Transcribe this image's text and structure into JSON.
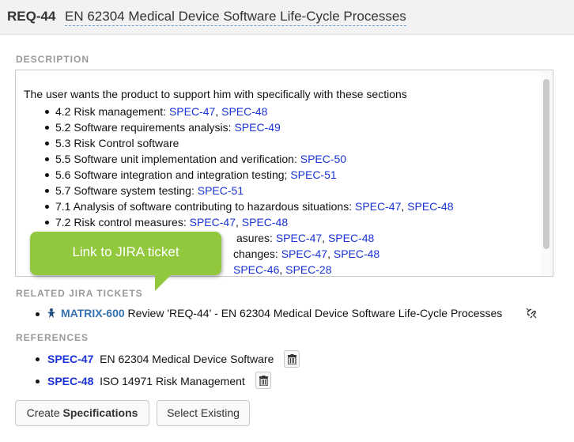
{
  "header": {
    "req_id": "REQ-44",
    "title": "EN 62304 Medical Device Software Life-Cycle Processes"
  },
  "description": {
    "label": "DESCRIPTION",
    "intro": "The user wants the product to support him with specifically with these sections",
    "items": [
      {
        "text": "4.2 Risk management: ",
        "links": [
          "SPEC-47",
          "SPEC-48"
        ]
      },
      {
        "text": "5.2 Software requirements analysis: ",
        "links": [
          "SPEC-49"
        ]
      },
      {
        "text": "5.3 Risk Control software",
        "links": []
      },
      {
        "text": "5.5 Software unit implementation and verification: ",
        "links": [
          "SPEC-50"
        ]
      },
      {
        "text": "5.6 Software integration and integration testing; ",
        "links": [
          "SPEC-51"
        ]
      },
      {
        "text": "5.7 Software system testing: ",
        "links": [
          "SPEC-51"
        ]
      },
      {
        "text": "7.1 Analysis of software contributing to hazardous situations: ",
        "links": [
          "SPEC-47",
          "SPEC-48"
        ]
      },
      {
        "text": "7.2 Risk control measures: ",
        "links": [
          "SPEC-47",
          "SPEC-48"
        ]
      },
      {
        "text": "asures: ",
        "links": [
          "SPEC-47",
          "SPEC-48"
        ]
      },
      {
        "text": "changes: ",
        "links": [
          "SPEC-47",
          "SPEC-48"
        ]
      },
      {
        "text": "",
        "links": [
          "SPEC-46",
          "SPEC-28"
        ]
      }
    ]
  },
  "callout": {
    "text": "Link to JIRA ticket"
  },
  "jira": {
    "label": "RELATED JIRA TICKETS",
    "key": "MATRIX-600",
    "summary": "Review 'REQ-44' - EN 62304 Medical Device Software Life-Cycle Processes"
  },
  "references": {
    "label": "REFERENCES",
    "items": [
      {
        "key": "SPEC-47",
        "title": "EN 62304 Medical Device Software"
      },
      {
        "key": "SPEC-48",
        "title": "ISO 14971 Risk Management"
      }
    ]
  },
  "buttons": {
    "create_prefix": "Create ",
    "create_bold": "Specifications",
    "select_existing": "Select Existing"
  },
  "colors": {
    "link": "#1a33d6",
    "jira_key": "#3572b0",
    "callout": "#92c83e",
    "label": "#999999"
  },
  "icons": {
    "jira": "jira-icon",
    "unlink": "unlink-icon",
    "trash": "trash-icon"
  }
}
